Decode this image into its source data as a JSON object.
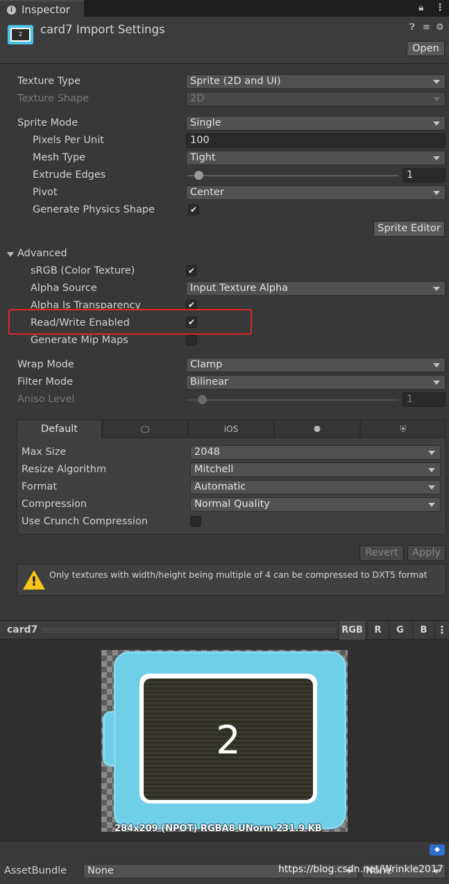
{
  "window": {
    "tab_title": "Inspector"
  },
  "header": {
    "title": "card7 Import Settings",
    "thumb_text": "2",
    "open_label": "Open"
  },
  "fields": {
    "texture_type": {
      "label": "Texture Type",
      "value": "Sprite (2D and UI)"
    },
    "texture_shape": {
      "label": "Texture Shape",
      "value": "2D"
    },
    "sprite_mode": {
      "label": "Sprite Mode",
      "value": "Single"
    },
    "pixels_per_unit": {
      "label": "Pixels Per Unit",
      "value": "100"
    },
    "mesh_type": {
      "label": "Mesh Type",
      "value": "Tight"
    },
    "extrude_edges": {
      "label": "Extrude Edges",
      "value": "1"
    },
    "pivot": {
      "label": "Pivot",
      "value": "Center"
    },
    "generate_physics_shape": {
      "label": "Generate Physics Shape",
      "checked": true
    },
    "sprite_editor_label": "Sprite Editor"
  },
  "advanced": {
    "label": "Advanced",
    "srgb": {
      "label": "sRGB (Color Texture)",
      "checked": true
    },
    "alpha_source": {
      "label": "Alpha Source",
      "value": "Input Texture Alpha"
    },
    "alpha_is_transparency": {
      "label": "Alpha Is Transparency",
      "checked": true
    },
    "read_write": {
      "label": "Read/Write Enabled",
      "checked": true
    },
    "generate_mip_maps": {
      "label": "Generate Mip Maps",
      "checked": false
    }
  },
  "wrap_mode": {
    "label": "Wrap Mode",
    "value": "Clamp"
  },
  "filter_mode": {
    "label": "Filter Mode",
    "value": "Bilinear"
  },
  "aniso_level": {
    "label": "Aniso Level",
    "value": "1"
  },
  "platform": {
    "tabs": [
      "Default",
      "standalone-icon",
      "iOS",
      "android-icon",
      "webgl-icon"
    ],
    "tab_default": "Default",
    "tab_ios": "iOS",
    "max_size": {
      "label": "Max Size",
      "value": "2048"
    },
    "resize_algorithm": {
      "label": "Resize Algorithm",
      "value": "Mitchell"
    },
    "format": {
      "label": "Format",
      "value": "Automatic"
    },
    "compression": {
      "label": "Compression",
      "value": "Normal Quality"
    },
    "use_crunch": {
      "label": "Use Crunch Compression",
      "checked": false
    }
  },
  "actions": {
    "revert": "Revert",
    "apply": "Apply"
  },
  "warning": "Only textures with width/height being multiple of 4 can be compressed to DXT5 format",
  "preview": {
    "name": "card7",
    "channels": [
      "RGB",
      "R",
      "G",
      "B"
    ],
    "card_number": "2",
    "info": "284x209 (NPOT)  RGBA8 UNorm   231.9 KB"
  },
  "asset_bundle": {
    "label": "AssetBundle",
    "value": "None",
    "variant": "None"
  },
  "watermark": "https://blog.csdn.net/Wrinkle2017",
  "colors": {
    "highlight": "#e0282a",
    "card_blue": "#6fcfe7",
    "warning_yellow": "#f5c518"
  }
}
